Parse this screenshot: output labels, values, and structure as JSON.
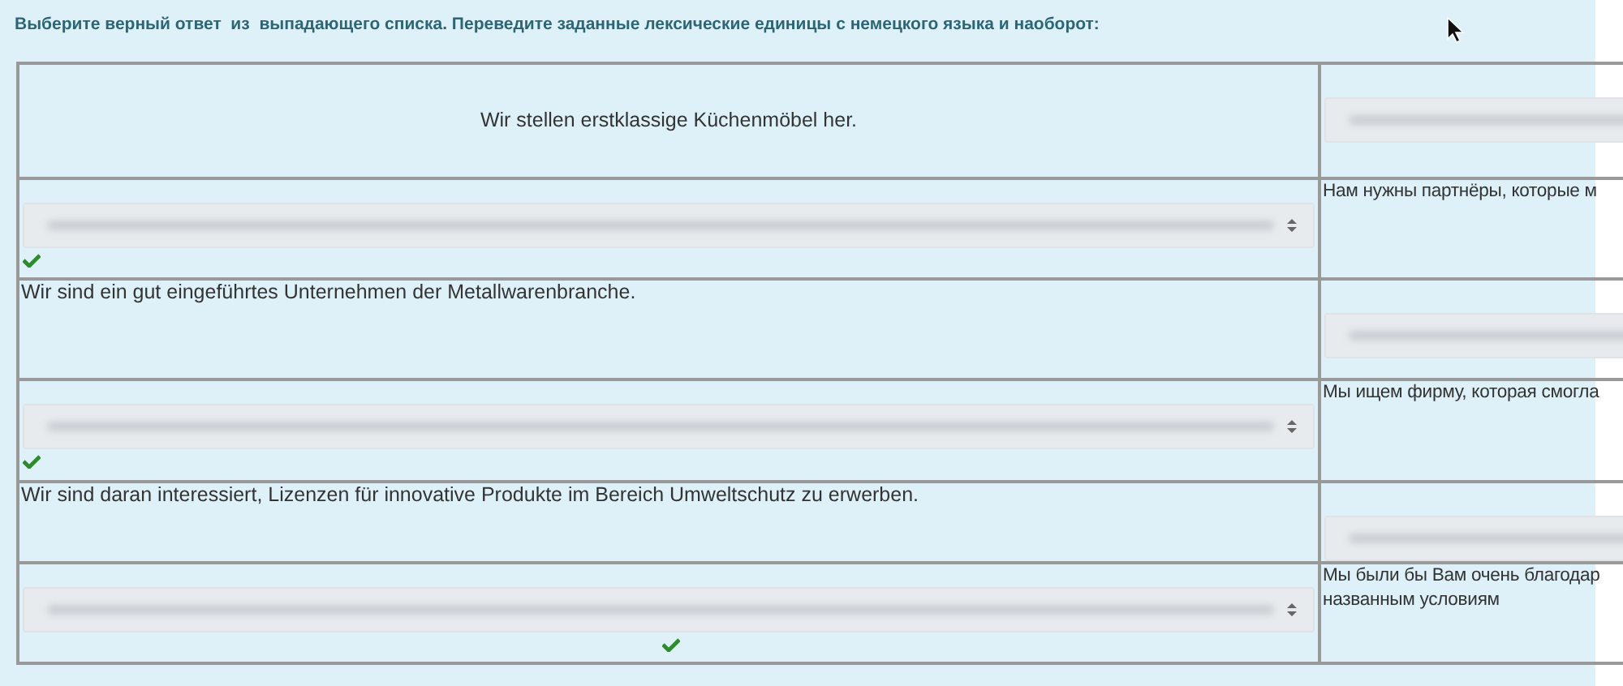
{
  "instruction": "Выберите верный ответ  из  выпадающего списка. Переведите заданные лексические единицы с немецкого языка и наоборот:",
  "rows": [
    {
      "left": {
        "kind": "text",
        "text": "Wir stellen erstklassige Küchenmöbel her.",
        "centered": true
      },
      "right": {
        "kind": "select"
      }
    },
    {
      "left": {
        "kind": "select",
        "checked": true,
        "check_centered": false
      },
      "right": {
        "kind": "text",
        "lines": [
          "Нам нужны партнёры, которые м"
        ]
      }
    },
    {
      "left": {
        "kind": "text",
        "text": "Wir sind ein gut eingeführtes Unternehmen der Metallwarenbranche.",
        "centered": false
      },
      "right": {
        "kind": "select"
      }
    },
    {
      "left": {
        "kind": "select",
        "checked": true,
        "check_centered": false
      },
      "right": {
        "kind": "text",
        "lines": [
          "Мы ищем фирму, которая смогла"
        ]
      }
    },
    {
      "left": {
        "kind": "text",
        "text": "Wir sind daran interessiert, Lizenzen für innovative Produkte im Bereich Umweltschutz zu erwerben.",
        "centered": false
      },
      "right": {
        "kind": "select"
      }
    },
    {
      "left": {
        "kind": "select",
        "checked": true,
        "check_centered": true
      },
      "right": {
        "kind": "text",
        "lines": [
          "Мы были бы Вам очень благодар",
          "названным условиям"
        ]
      }
    }
  ]
}
